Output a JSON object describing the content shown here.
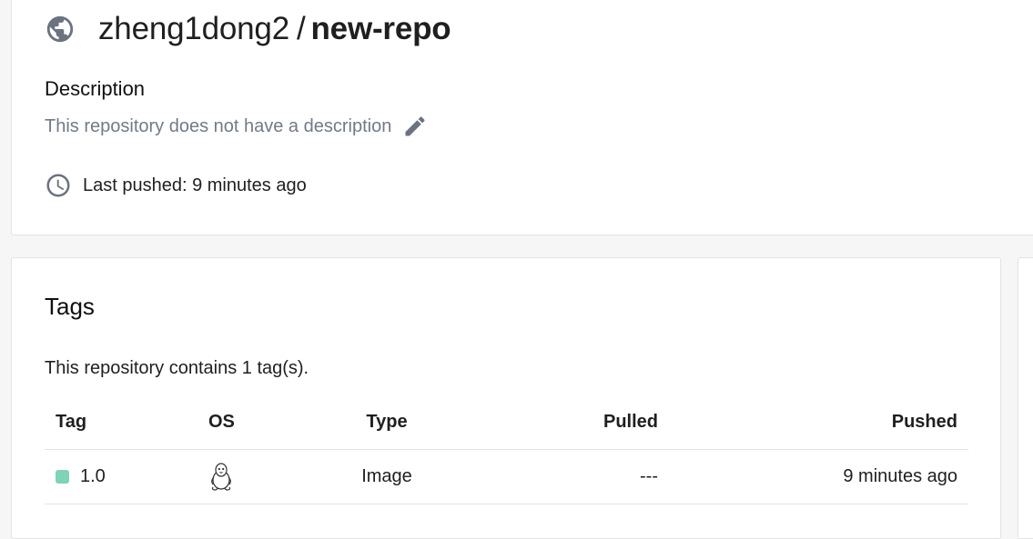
{
  "repo": {
    "namespace": "zheng1dong2",
    "separator": "/",
    "name": "new-repo",
    "visibility_icon": "globe-icon"
  },
  "description": {
    "heading": "Description",
    "text": "This repository does not have a description",
    "edit_icon": "pencil-icon"
  },
  "last_pushed": {
    "icon": "clock-icon",
    "text": "Last pushed: 9 minutes ago"
  },
  "tags": {
    "title": "Tags",
    "summary": "This repository contains 1 tag(s).",
    "columns": [
      "Tag",
      "OS",
      "Type",
      "Pulled",
      "Pushed"
    ],
    "rows": [
      {
        "tag": "1.0",
        "status_color": "#7fd3b7",
        "os_icon": "linux-icon",
        "type": "Image",
        "pulled": "---",
        "pushed": "9 minutes ago"
      }
    ]
  }
}
